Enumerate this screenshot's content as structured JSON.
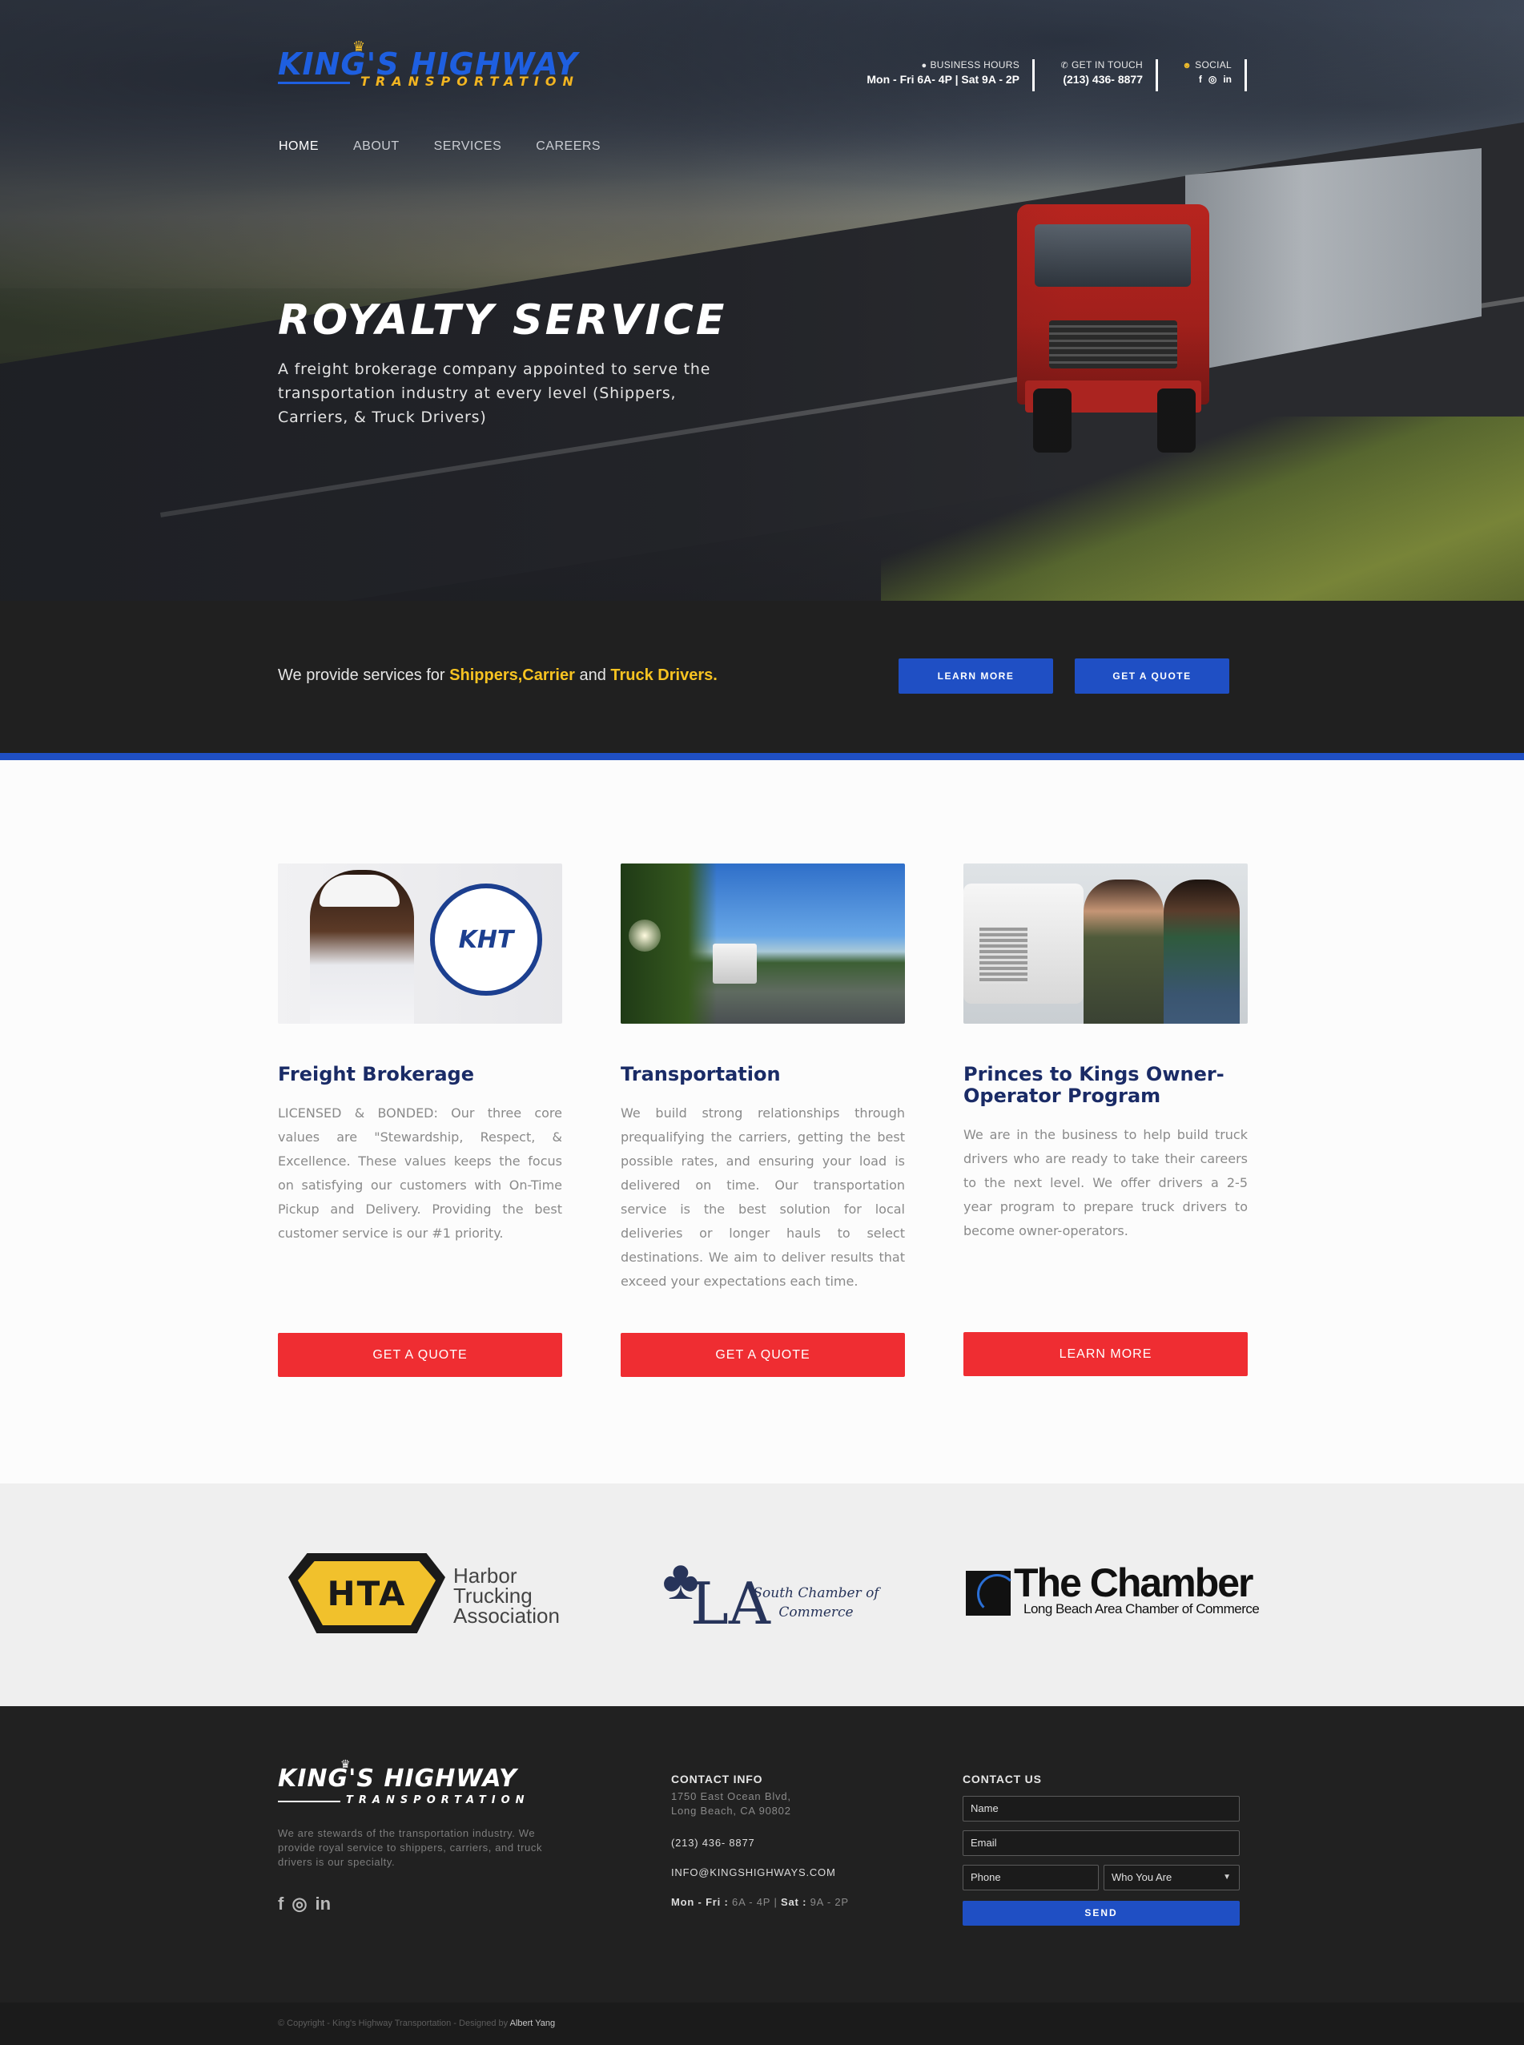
{
  "brand": {
    "name": "KING'S HIGHWAY",
    "sub": "TRANSPORTATION"
  },
  "header": {
    "hours_label": "BUSINESS HOURS",
    "hours_value": "Mon - Fri 6A- 4P | Sat 9A - 2P",
    "touch_label": "GET IN TOUCH",
    "touch_value": "(213) 436- 8877",
    "social_label": "SOCIAL",
    "social_icons": [
      "facebook-icon",
      "instagram-icon",
      "linkedin-icon"
    ]
  },
  "nav": {
    "items": [
      "HOME",
      "ABOUT",
      "SERVICES",
      "CAREERS"
    ]
  },
  "hero": {
    "title": "ROYALTY SERVICE",
    "text": "A freight brokerage company appointed to serve the transportation industry at every level (Shippers, Carriers, & Truck Drivers)"
  },
  "cta": {
    "prefix": "We provide services for ",
    "shippers": "Shippers",
    "comma": ",",
    "carrier": "Carrier",
    "and": " and ",
    "drivers": "Truck Drivers.",
    "learn_more": "LEARN MORE",
    "get_quote": "GET A QUOTE"
  },
  "services": [
    {
      "title": "Freight Brokerage",
      "text": "LICENSED & BONDED: Our three core values are \"Stewardship, Respect, & Excellence. These values keeps the focus on satisfying our customers with On-Time Pickup and Delivery. Providing the best customer service is our #1 priority.",
      "button": "GET A QUOTE",
      "badge": "KHT"
    },
    {
      "title": "Transportation",
      "text": "We build strong relationships through prequalifying the carriers, getting the best possible rates, and ensuring your load is delivered on time. Our transportation service is the best solution for local deliveries or longer hauls to select destinations. We aim to deliver results that exceed your expectations each time.",
      "button": "GET A QUOTE"
    },
    {
      "title": "Princes to Kings Owner-Operator Program",
      "text": "We are in the business to help build truck drivers who are ready to take their careers to the next level. We offer drivers a 2-5 year program to prepare truck drivers to become owner-operators.",
      "button": "LEARN MORE"
    }
  ],
  "partners": {
    "hta_mark": "HTA",
    "hta_line1": "Harbor",
    "hta_line2": "Trucking",
    "hta_line3": "Association",
    "la_mark": "LA",
    "la_text": "South Chamber of Commerce",
    "chamber_title": "The Chamber",
    "chamber_sub": "Long Beach Area Chamber of Commerce"
  },
  "footer": {
    "about": "We are stewards of the transportation industry. We provide royal service to shippers, carriers, and truck drivers is our specialty.",
    "contact_title": "CONTACT INFO",
    "address1": "1750 East Ocean Blvd,",
    "address2": "Long Beach, CA 90802",
    "phone": "(213) 436- 8877",
    "email": "INFO@KINGSHIGHWAYS.COM",
    "hours_mf_label": "Mon - Fri :",
    "hours_mf": " 6A - 4P | ",
    "hours_sat_label": "Sat :",
    "hours_sat": " 9A - 2P",
    "form_title": "CONTACT US",
    "name_ph": "Name",
    "email_ph": "Email",
    "phone_ph": "Phone",
    "who_value": "Who You Are",
    "send": "SEND"
  },
  "copyright": {
    "text": "© Copyright - King's Highway Transportation - Designed by ",
    "designer": "Albert Yang"
  },
  "colors": {
    "brand_blue": "#1f4fc4",
    "accent_yellow": "#f7c321",
    "button_red": "#ef2d32",
    "heading_navy": "#1a2b66"
  }
}
